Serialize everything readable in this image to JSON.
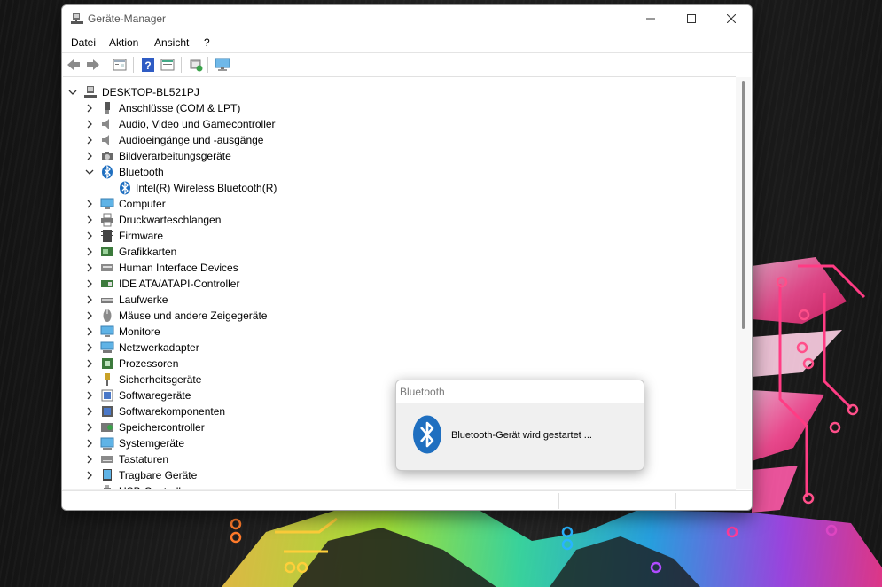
{
  "window": {
    "title": "Geräte-Manager",
    "controls": {
      "minimize": "minimize-icon",
      "maximize": "maximize-icon",
      "close": "close-icon"
    }
  },
  "menu": [
    "Datei",
    "Aktion",
    "Ansicht",
    "?"
  ],
  "toolbar": [
    "back-icon",
    "forward-icon",
    "properties-view-icon",
    "help-icon",
    "details-view-icon",
    "scan-hardware-icon",
    "monitor-icon"
  ],
  "tree": {
    "root": "DESKTOP-BL521PJ",
    "items": [
      {
        "label": "Anschlüsse (COM & LPT)",
        "icon": "port-icon",
        "expanded": false
      },
      {
        "label": "Audio, Video und Gamecontroller",
        "icon": "speaker-icon",
        "expanded": false
      },
      {
        "label": "Audioeingänge und -ausgänge",
        "icon": "speaker-icon",
        "expanded": false
      },
      {
        "label": "Bildverarbeitungsgeräte",
        "icon": "camera-icon",
        "expanded": false
      },
      {
        "label": "Bluetooth",
        "icon": "bluetooth-icon",
        "expanded": true
      },
      {
        "label": "Intel(R) Wireless Bluetooth(R)",
        "icon": "bluetooth-icon",
        "child": true
      },
      {
        "label": "Computer",
        "icon": "computer-icon",
        "expanded": false
      },
      {
        "label": "Druckwarteschlangen",
        "icon": "printer-icon",
        "expanded": false
      },
      {
        "label": "Firmware",
        "icon": "firmware-icon",
        "expanded": false
      },
      {
        "label": "Grafikkarten",
        "icon": "display-adapter-icon",
        "expanded": false
      },
      {
        "label": "Human Interface Devices",
        "icon": "hid-icon",
        "expanded": false
      },
      {
        "label": "IDE ATA/ATAPI-Controller",
        "icon": "ide-controller-icon",
        "expanded": false
      },
      {
        "label": "Laufwerke",
        "icon": "drive-icon",
        "expanded": false
      },
      {
        "label": "Mäuse und andere Zeigegeräte",
        "icon": "mouse-icon",
        "expanded": false
      },
      {
        "label": "Monitore",
        "icon": "monitor-icon",
        "expanded": false
      },
      {
        "label": "Netzwerkadapter",
        "icon": "network-icon",
        "expanded": false
      },
      {
        "label": "Prozessoren",
        "icon": "processor-icon",
        "expanded": false
      },
      {
        "label": "Sicherheitsgeräte",
        "icon": "security-key-icon",
        "expanded": false
      },
      {
        "label": "Softwaregeräte",
        "icon": "software-device-icon",
        "expanded": false
      },
      {
        "label": "Softwarekomponenten",
        "icon": "software-component-icon",
        "expanded": false
      },
      {
        "label": "Speichercontroller",
        "icon": "storage-controller-icon",
        "expanded": false
      },
      {
        "label": "Systemgeräte",
        "icon": "system-device-icon",
        "expanded": false
      },
      {
        "label": "Tastaturen",
        "icon": "keyboard-icon",
        "expanded": false
      },
      {
        "label": "Tragbare Geräte",
        "icon": "portable-device-icon",
        "expanded": false
      },
      {
        "label": "USB-Controller",
        "icon": "usb-icon",
        "expanded": true
      }
    ]
  },
  "notification": {
    "title": "Bluetooth",
    "message": "Bluetooth-Gerät wird gestartet ...",
    "icon": "bluetooth-icon"
  },
  "colors": {
    "bluetooth": "#1f6fc0",
    "window_bg": "#ffffff",
    "popup_bg": "#f0f0f0"
  }
}
